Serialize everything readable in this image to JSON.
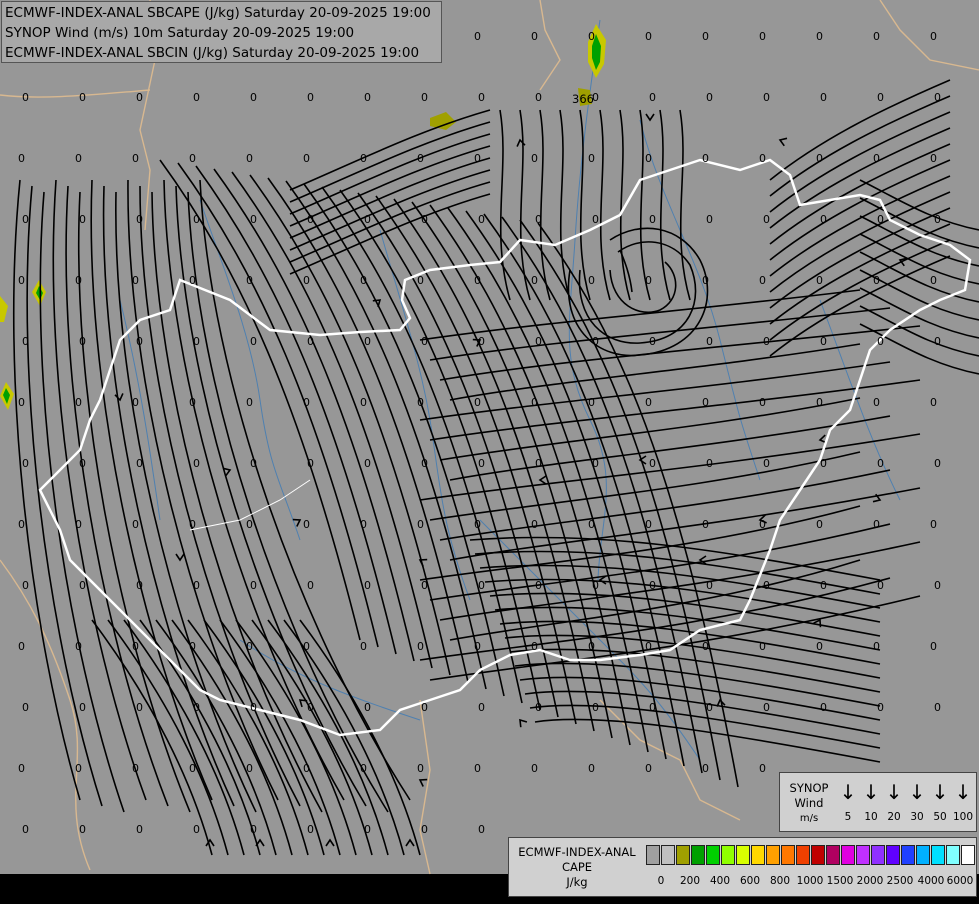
{
  "header": {
    "line1": "ECMWF-INDEX-ANAL SBCAPE (J/kg) Saturday 20-09-2025 19:00",
    "line2": "SYNOP Wind (m/s) 10m Saturday 20-09-2025 19:00",
    "line3": "ECMWF-INDEX-ANAL SBCIN (J/kg) Saturday 20-09-2025 19:00"
  },
  "map": {
    "background_color": "#979797",
    "streamline_color": "#000000",
    "border_color": "#ffffff",
    "neighbor_border_color": "#d8b890",
    "river_color": "#4f80b0",
    "grid_value": "0",
    "cape_label": "366"
  },
  "wind_legend": {
    "title": "SYNOP",
    "subtitle": "Wind",
    "units": "m/s",
    "arrow_glyph": "↓",
    "speeds": [
      "5",
      "10",
      "20",
      "30",
      "50",
      "100"
    ]
  },
  "cape_legend": {
    "title": "ECMWF-INDEX-ANAL",
    "subtitle": "CAPE",
    "units": "J/kg",
    "colors": [
      "#a0a0a0",
      "#c0c0c0",
      "#a0a000",
      "#00a000",
      "#00d000",
      "#90ff00",
      "#d8ff00",
      "#ffd800",
      "#ffa000",
      "#ff7800",
      "#f04000",
      "#c00000",
      "#b00060",
      "#e000e0",
      "#c030ff",
      "#9030ff",
      "#6000ff",
      "#2040ff",
      "#00b0ff",
      "#00e0ff",
      "#80ffff",
      "#ffffff"
    ],
    "ticks": [
      "0",
      "200",
      "400",
      "600",
      "800",
      "1000",
      "1500",
      "2000",
      "2500",
      "4000",
      "6000"
    ]
  }
}
